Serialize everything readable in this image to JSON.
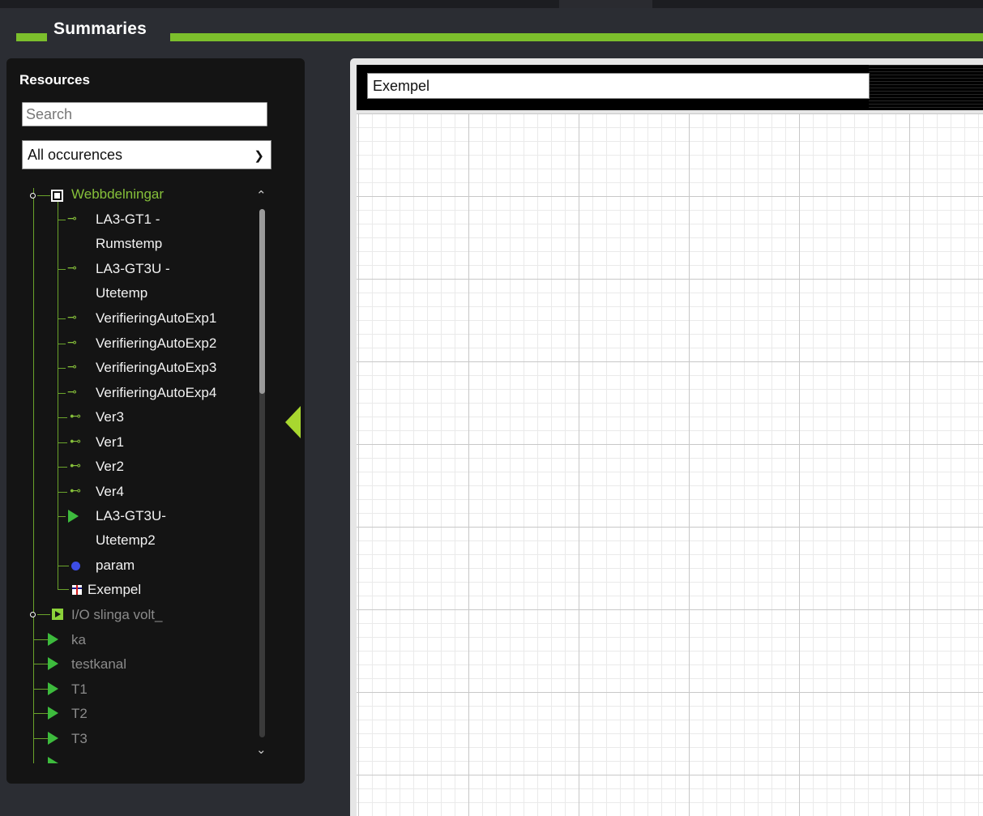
{
  "header": {
    "title": "Summaries"
  },
  "sidebar": {
    "title": "Resources",
    "search_placeholder": "Search",
    "filter_selected": "All occurences",
    "tree": [
      {
        "label": "Webbdelningar",
        "icon": "group-square-icon",
        "level": 0
      },
      {
        "label": "LA3-GT1 -",
        "label2": "Rumstemp",
        "icon": "key-icon",
        "level": 1
      },
      {
        "label": "LA3-GT3U -",
        "label2": "Utetemp",
        "icon": "key-icon",
        "level": 1
      },
      {
        "label": "VerifieringAutoExp1",
        "icon": "key-icon",
        "level": 1
      },
      {
        "label": "VerifieringAutoExp2",
        "icon": "key-icon",
        "level": 1
      },
      {
        "label": "VerifieringAutoExp3",
        "icon": "key-icon",
        "level": 1
      },
      {
        "label": "VerifieringAutoExp4",
        "icon": "key-icon",
        "level": 1
      },
      {
        "label": "Ver3",
        "icon": "output-icon",
        "level": 1
      },
      {
        "label": "Ver1",
        "icon": "output-icon",
        "level": 1
      },
      {
        "label": "Ver2",
        "icon": "output-icon",
        "level": 1
      },
      {
        "label": "Ver4",
        "icon": "output-icon",
        "level": 1
      },
      {
        "label": "LA3-GT3U-",
        "label2": "Utetemp2",
        "icon": "play-triangle-icon",
        "level": 1
      },
      {
        "label": "param",
        "icon": "blue-dot-icon",
        "level": 1
      },
      {
        "label": "Exempel",
        "icon": "table-icon",
        "level": 1
      },
      {
        "label": "I/O slinga volt_",
        "icon": "io-icon",
        "level": 0
      },
      {
        "label": "ka",
        "icon": "play-triangle-icon",
        "level": 1
      },
      {
        "label": "testkanal",
        "icon": "play-triangle-icon",
        "level": 1
      },
      {
        "label": "T1",
        "icon": "play-triangle-icon",
        "level": 1
      },
      {
        "label": "T2",
        "icon": "play-triangle-icon",
        "level": 1
      },
      {
        "label": "T3",
        "icon": "play-triangle-icon",
        "level": 1
      }
    ]
  },
  "editor": {
    "name_value": "Exempel"
  },
  "colors": {
    "accent": "#7cbf2c",
    "tree_line": "#6aa32b",
    "background": "#2b2d33",
    "sidebar": "#141414"
  }
}
